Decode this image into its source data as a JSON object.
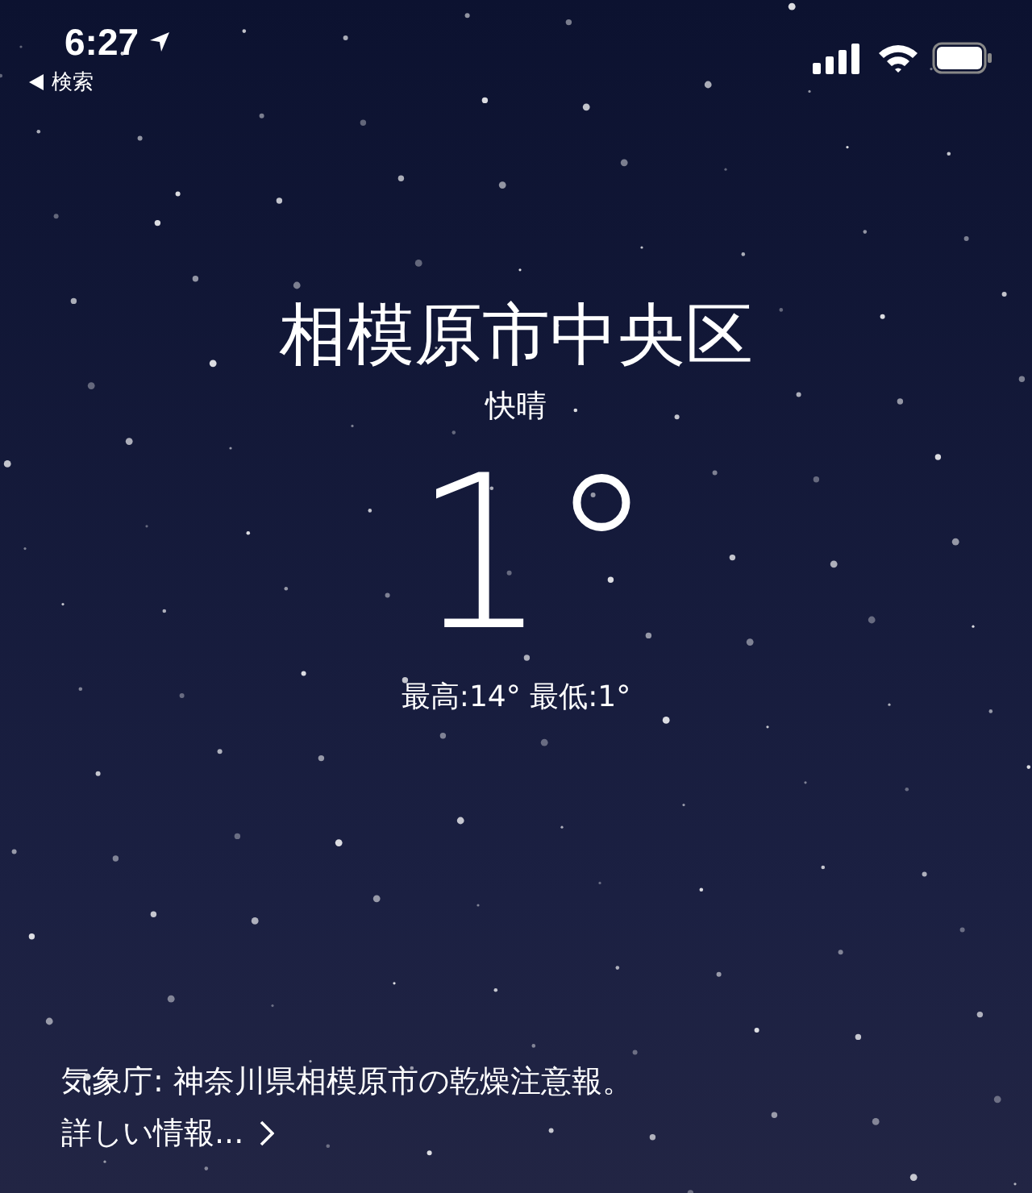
{
  "status_bar": {
    "time": "6:27",
    "back_label": "検索"
  },
  "location": "相模原市中央区",
  "condition": "快晴",
  "temperature": "1°",
  "high_low": "最高:14° 最低:1°",
  "alert": {
    "text": "気象庁: 神奈川県相模原市の乾燥注意報。",
    "link": "詳しい情報..."
  }
}
